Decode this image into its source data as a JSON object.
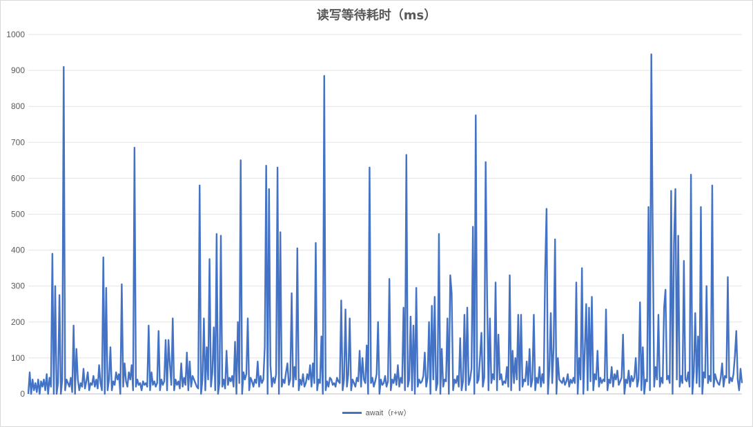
{
  "chart_data": {
    "type": "line",
    "title": "读写等待耗时（ms）",
    "xlabel": "",
    "ylabel": "",
    "ylim": [
      0,
      1000
    ],
    "yticks": [
      "0",
      "100",
      "200",
      "300",
      "400",
      "500",
      "600",
      "700",
      "800",
      "900",
      "1000"
    ],
    "grid": "horizontal",
    "legend_position": "bottom",
    "series_color": "#4472c4",
    "series": [
      {
        "name": "await（r+w）",
        "values": [
          0,
          60,
          0,
          40,
          10,
          30,
          5,
          40,
          0,
          35,
          20,
          40,
          10,
          55,
          0,
          45,
          20,
          390,
          0,
          300,
          0,
          30,
          275,
          0,
          40,
          910,
          10,
          40,
          30,
          20,
          45,
          5,
          190,
          0,
          125,
          40,
          10,
          30,
          20,
          70,
          15,
          35,
          60,
          10,
          30,
          25,
          50,
          20,
          40,
          15,
          80,
          30,
          10,
          380,
          0,
          295,
          10,
          40,
          130,
          10,
          35,
          25,
          60,
          40,
          55,
          0,
          305,
          20,
          85,
          35,
          20,
          60,
          40,
          80,
          10,
          685,
          20,
          40,
          25,
          30,
          10,
          35,
          25,
          30,
          20,
          190,
          10,
          60,
          25,
          35,
          20,
          30,
          175,
          10,
          40,
          25,
          35,
          150,
          10,
          150,
          80,
          25,
          210,
          10,
          40,
          25,
          35,
          15,
          85,
          20,
          45,
          25,
          115,
          10,
          90,
          20,
          50,
          40,
          30,
          20,
          15,
          580,
          0,
          40,
          210,
          10,
          130,
          40,
          375,
          20,
          60,
          185,
          10,
          445,
          0,
          30,
          440,
          20,
          40,
          15,
          120,
          25,
          45,
          35,
          50,
          20,
          145,
          0,
          200,
          30,
          650,
          0,
          60,
          40,
          55,
          210,
          10,
          45,
          35,
          20,
          40,
          30,
          90,
          20,
          50,
          30,
          40,
          130,
          635,
          0,
          570,
          80,
          20,
          45,
          30,
          55,
          630,
          0,
          450,
          20,
          40,
          30,
          60,
          85,
          25,
          40,
          280,
          20,
          75,
          40,
          405,
          10,
          40,
          25,
          55,
          20,
          30,
          55,
          40,
          80,
          20,
          85,
          30,
          420,
          10,
          40,
          30,
          160,
          0,
          885,
          10,
          35,
          20,
          45,
          40,
          25,
          30,
          20,
          45,
          35,
          30,
          260,
          10,
          40,
          235,
          20,
          55,
          210,
          10,
          40,
          30,
          20,
          45,
          35,
          120,
          20,
          100,
          40,
          30,
          135,
          0,
          630,
          30,
          45,
          20,
          35,
          55,
          200,
          0,
          40,
          25,
          30,
          50,
          20,
          35,
          320,
          10,
          40,
          30,
          55,
          25,
          80,
          20,
          45,
          30,
          240,
          10,
          665,
          20,
          40,
          215,
          10,
          190,
          0,
          295,
          20,
          40,
          30,
          35,
          50,
          115,
          20,
          45,
          200,
          0,
          245,
          40,
          270,
          10,
          30,
          445,
          0,
          125,
          20,
          40,
          35,
          210,
          0,
          330,
          280,
          10,
          40,
          30,
          50,
          20,
          155,
          10,
          35,
          220,
          10,
          240,
          25,
          40,
          70,
          465,
          0,
          775,
          30,
          40,
          100,
          170,
          20,
          45,
          645,
          280,
          10,
          210,
          30,
          55,
          40,
          310,
          10,
          165,
          40,
          55,
          25,
          35,
          30,
          75,
          20,
          330,
          10,
          120,
          30,
          100,
          40,
          220,
          10,
          220,
          20,
          40,
          35,
          90,
          25,
          125,
          20,
          40,
          220,
          10,
          45,
          30,
          75,
          20,
          55,
          30,
          340,
          515,
          0,
          70,
          225,
          30,
          130,
          430,
          0,
          100,
          40,
          35,
          30,
          45,
          25,
          35,
          55,
          20,
          40,
          30,
          45,
          30,
          310,
          0,
          100,
          40,
          350,
          0,
          120,
          250,
          10,
          240,
          35,
          270,
          10,
          55,
          40,
          120,
          20,
          45,
          30,
          40,
          35,
          235,
          10,
          40,
          30,
          75,
          20,
          55,
          40,
          65,
          25,
          35,
          45,
          165,
          0,
          40,
          30,
          65,
          20,
          50,
          35,
          45,
          100,
          20,
          40,
          255,
          10,
          130,
          0,
          40,
          35,
          520,
          10,
          945,
          435,
          20,
          75,
          40,
          220,
          20,
          45,
          30,
          240,
          290,
          40,
          50,
          30,
          565,
          0,
          420,
          570,
          40,
          440,
          20,
          50,
          30,
          370,
          40,
          35,
          60,
          20,
          610,
          0,
          60,
          225,
          30,
          160,
          20,
          520,
          0,
          60,
          45,
          300,
          30,
          50,
          35,
          580,
          20,
          55,
          40,
          30,
          25,
          45,
          85,
          20,
          50,
          45,
          325,
          30,
          45,
          35,
          55,
          105,
          175,
          40,
          10,
          70,
          30
        ]
      }
    ]
  }
}
